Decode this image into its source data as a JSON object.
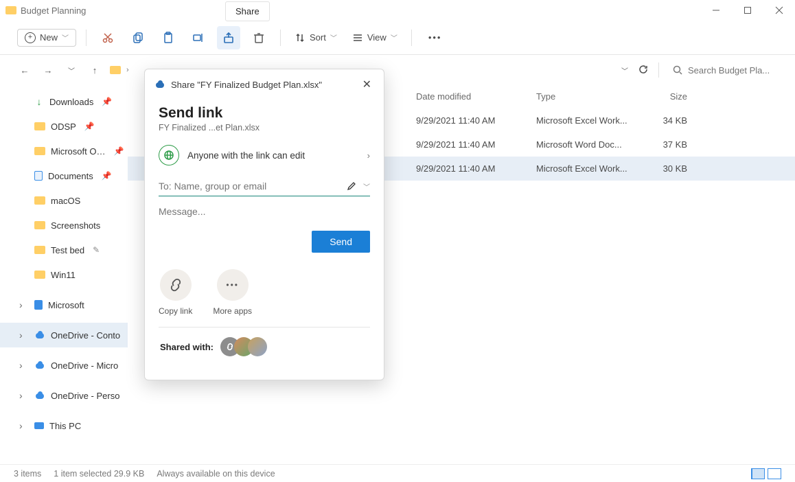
{
  "window": {
    "title": "Budget Planning",
    "share_tab": "Share"
  },
  "toolbar": {
    "new_label": "New",
    "sort_label": "Sort",
    "view_label": "View"
  },
  "search": {
    "placeholder": "Search Budget Pla..."
  },
  "sidebar": {
    "items": [
      {
        "label": "Downloads",
        "icon": "download",
        "pinned": true
      },
      {
        "label": "ODSP",
        "icon": "folder",
        "pinned": true
      },
      {
        "label": "Microsoft O…",
        "icon": "folder",
        "pinned": true
      },
      {
        "label": "Documents",
        "icon": "doc",
        "pinned": true
      },
      {
        "label": "macOS",
        "icon": "folder"
      },
      {
        "label": "Screenshots",
        "icon": "folder"
      },
      {
        "label": "Test bed",
        "icon": "folder",
        "edit": true
      },
      {
        "label": "Win11",
        "icon": "folder"
      },
      {
        "label": "Microsoft",
        "icon": "ms",
        "expandable": true
      },
      {
        "label": "OneDrive - Conto",
        "icon": "cloud",
        "expandable": true,
        "selected": true
      },
      {
        "label": "OneDrive - Micro",
        "icon": "cloud",
        "expandable": true
      },
      {
        "label": "OneDrive - Perso",
        "icon": "cloud",
        "expandable": true
      },
      {
        "label": "This PC",
        "icon": "monitor",
        "expandable": true
      }
    ]
  },
  "file_headers": {
    "name": "",
    "date": "Date modified",
    "type": "Type",
    "size": "Size"
  },
  "file_rows": [
    {
      "date": "9/29/2021 11:40 AM",
      "type": "Microsoft Excel Work...",
      "size": "34 KB",
      "selected": false
    },
    {
      "date": "9/29/2021 11:40 AM",
      "type": "Microsoft Word Doc...",
      "size": "37 KB",
      "selected": false
    },
    {
      "date": "9/29/2021 11:40 AM",
      "type": "Microsoft Excel Work...",
      "size": "30 KB",
      "selected": true
    }
  ],
  "status": {
    "items": "3 items",
    "selected": "1 item selected  29.9 KB",
    "availability": "Always available on this device"
  },
  "dialog": {
    "title": "Share \"FY Finalized Budget Plan.xlsx\"",
    "heading": "Send link",
    "filename": "FY Finalized ...et Plan.xlsx",
    "permission": "Anyone with the link can edit",
    "to_placeholder": "To: Name, group or email",
    "message_placeholder": "Message...",
    "send": "Send",
    "copy_link": "Copy link",
    "more_apps": "More apps",
    "shared_with": "Shared with:"
  }
}
